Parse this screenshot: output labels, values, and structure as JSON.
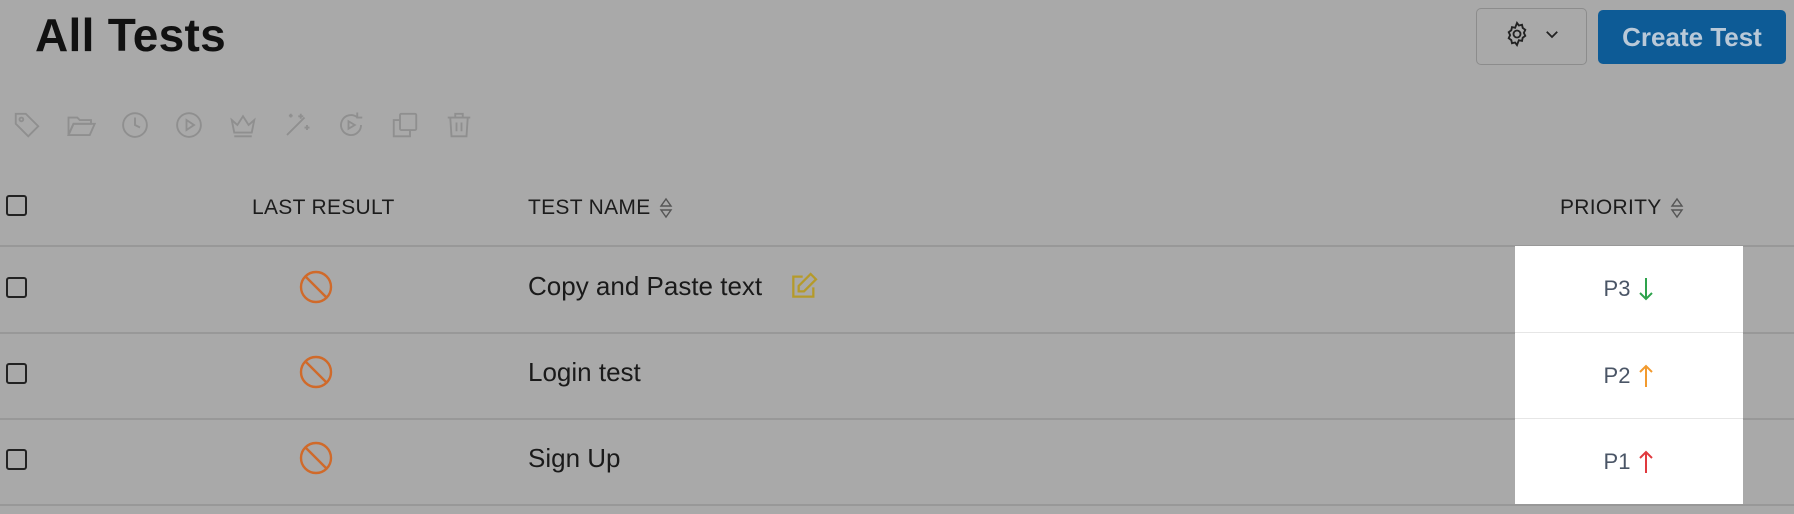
{
  "header": {
    "title": "All Tests",
    "create_label": "Create Test"
  },
  "icons": {
    "settings": "gear-icon",
    "dropdown": "chevron-down-icon",
    "toolbar": [
      "tag-icon",
      "folder-open-icon",
      "clock-icon",
      "play-icon",
      "crown-icon",
      "magic-wand-icon",
      "rerun-icon",
      "copy-icon",
      "trash-icon"
    ],
    "result": "blocked-icon",
    "edit": "edit-icon"
  },
  "table": {
    "columns": {
      "last_result": "LAST RESULT",
      "test_name": "TEST NAME",
      "priority": "PRIORITY"
    },
    "rows": [
      {
        "name": "Copy and Paste text",
        "priority": "P3",
        "priority_dir": "down",
        "priority_color": "#2ea34c",
        "editable": true
      },
      {
        "name": "Login test",
        "priority": "P2",
        "priority_dir": "up",
        "priority_color": "#f29a2e",
        "editable": false
      },
      {
        "name": "Sign Up",
        "priority": "P1",
        "priority_dir": "up",
        "priority_color": "#e0393e",
        "editable": false
      }
    ]
  },
  "colors": {
    "accent": "#0d5b96",
    "result_icon": "#d06a2a",
    "edit_icon": "#b59a2a"
  }
}
